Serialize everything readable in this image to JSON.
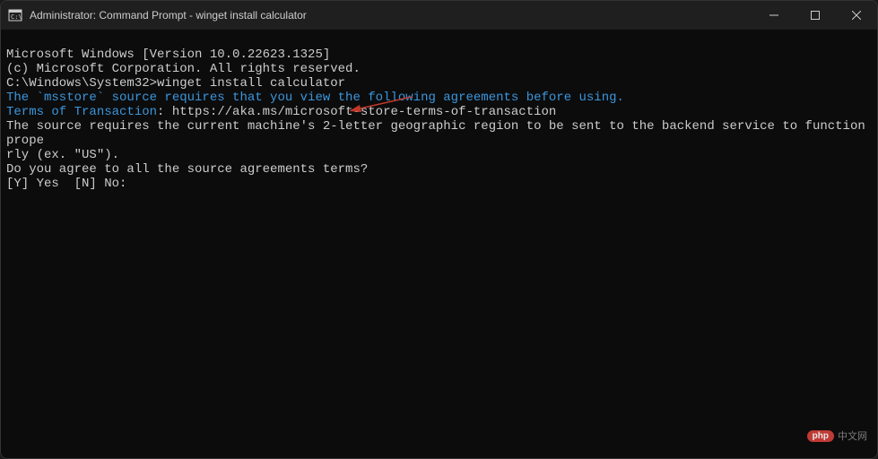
{
  "window": {
    "title": "Administrator: Command Prompt - winget  install calculator"
  },
  "terminal": {
    "line1": "Microsoft Windows [Version 10.0.22623.1325]",
    "line2": "(c) Microsoft Corporation. All rights reserved.",
    "blank1": "",
    "prompt": "C:\\Windows\\System32>",
    "command": "winget install calculator",
    "msg1": "The `msstore` source requires that you view the following agreements before using.",
    "terms_label": "Terms of Transaction",
    "terms_sep": ": ",
    "terms_url": "https://aka.ms/microsoft-store-terms-of-transaction",
    "msg2a": "The source requires the current machine's 2-letter geographic region to be sent to the backend service to function prope",
    "msg2b": "rly (ex. \"US\").",
    "blank2": "",
    "question": "Do you agree to all the source agreements terms?",
    "options": "[Y] Yes  [N] No:"
  },
  "watermark": {
    "badge": "php",
    "text": "中文网"
  },
  "colors": {
    "cyan": "#3a96dd",
    "text": "#cccccc",
    "bg": "#0c0c0c",
    "titlebar": "#1f1f1f",
    "arrow": "#c0392b"
  }
}
